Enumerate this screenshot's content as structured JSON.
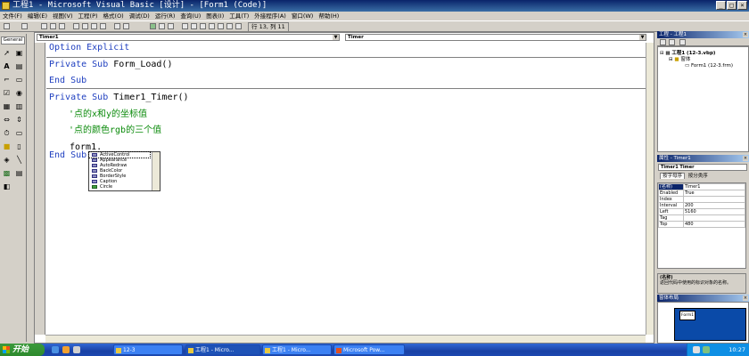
{
  "window": {
    "title": "工程1 - Microsoft Visual Basic [设计] - [Form1 (Code)]"
  },
  "menu": {
    "items": [
      "文件(F)",
      "编辑(E)",
      "视图(V)",
      "工程(P)",
      "格式(O)",
      "调试(D)",
      "运行(R)",
      "查询(U)",
      "图表(I)",
      "工具(T)",
      "外接程序(A)",
      "窗口(W)",
      "帮助(H)"
    ]
  },
  "toolbar": {
    "caret_position": "行 13, 列 11"
  },
  "toolbox": {
    "title": "General"
  },
  "code_window": {
    "object_combo": "Timer1",
    "proc_combo": "Timer",
    "lines": {
      "l1": "Option Explicit",
      "l2a": "Private Sub ",
      "l2b": "Form_Load()",
      "l3": "End Sub",
      "l4a": "Private Sub ",
      "l4b": "Timer1_Timer()",
      "l5": "'点的x和y的坐标值",
      "l6": "'点的颜色rgb的三个值",
      "l7": "form1.",
      "l8": "End Sub"
    },
    "autocomplete": [
      "ActiveControl",
      "Appearance",
      "AutoRedraw",
      "BackColor",
      "BorderStyle",
      "Caption",
      "Circle"
    ]
  },
  "project": {
    "title": "工程 - 工程1",
    "tree": [
      "工程1 (12-3.vbp)",
      "窗体",
      "Form1 (12-3.frm)"
    ]
  },
  "properties": {
    "title": "属性 - Timer1",
    "object": "Timer1 Timer",
    "tabs": [
      "按字母序",
      "按分类序"
    ],
    "rows": [
      {
        "name": "(名称)",
        "value": "Timer1"
      },
      {
        "name": "Enabled",
        "value": "True"
      },
      {
        "name": "Index",
        "value": ""
      },
      {
        "name": "Interval",
        "value": "200"
      },
      {
        "name": "Left",
        "value": "5160"
      },
      {
        "name": "Tag",
        "value": ""
      },
      {
        "name": "Top",
        "value": "480"
      }
    ],
    "desc_title": "(名称)",
    "desc_text": "返回代码中使用的标识对象的名称。"
  },
  "layout_window": {
    "title": "窗体布局",
    "form_label": "Form1"
  },
  "taskbar": {
    "start": "开始",
    "buttons": [
      "12-3",
      "工程1 - Micro...",
      "工程1 - Micro...",
      "Microsoft Pow..."
    ],
    "clock": "10:27"
  },
  "colors": {
    "title_bar": "#0a246a",
    "keyword": "#2040c0",
    "comment": "#0a8a0a",
    "taskbar": "#245edb"
  }
}
